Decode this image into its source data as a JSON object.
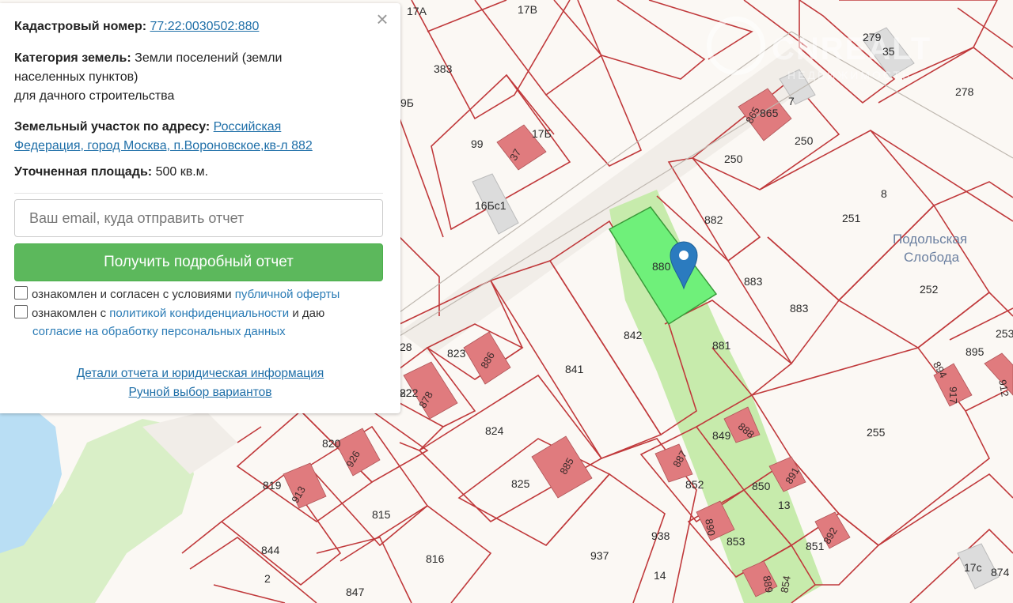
{
  "panel": {
    "close_label": "×",
    "cadastral": {
      "label": "Кадастровый номер:",
      "value": "77:22:0030502:880"
    },
    "category": {
      "label": "Категория земель:",
      "value_line1": "Земли поселений (земли",
      "value_line2": "населенных пунктов)",
      "value_line3": "для дачного строительства"
    },
    "address": {
      "label": "Земельный участок по адресу:",
      "value_line1": "Российская",
      "value_line2": "Федерация, город Москва, п.Вороновское,кв-л 882"
    },
    "area": {
      "label": "Уточненная площадь:",
      "value": "500 кв.м."
    },
    "email_placeholder": "Ваш email, куда отправить отчет",
    "submit_label": "Получить подробный отчет",
    "consent1": {
      "text": "ознакомлен и согласен с условиями",
      "link": "публичной оферты"
    },
    "consent2": {
      "text": "ознакомлен с",
      "link1": "политикой конфиденциальности",
      "text2": "и даю",
      "link2": "согласие на обработку персональных данных"
    },
    "details_link": "Детали отчета и юридическая информация",
    "manual_link": "Ручной выбор вариантов"
  },
  "map": {
    "watermark": "CNREALT",
    "watermark_sub": "НЕДВИЖИМОСТЬ",
    "area_name_line1": "Подольская",
    "area_name_line2": "Слобода",
    "plot_labels": [
      "17А",
      "17В",
      "383",
      "99",
      "17Б",
      "16Бс1",
      "279",
      "35",
      "7",
      "278",
      "250",
      "250",
      "8",
      "882",
      "880",
      "251",
      "252",
      "883",
      "883",
      "881",
      "842",
      "841",
      "823",
      "824",
      "825",
      "822",
      "820",
      "819",
      "815",
      "816",
      "844",
      "847",
      "937",
      "938",
      "852",
      "849",
      "850",
      "851",
      "853",
      "255",
      "895",
      "253",
      "13",
      "14",
      "874",
      "17с",
      "2",
      "28",
      "22",
      "9Б",
      "865"
    ],
    "house_labels": [
      "37",
      "865",
      "886",
      "878",
      "885",
      "926",
      "913",
      "887",
      "888",
      "891",
      "892",
      "890",
      "889",
      "854",
      "894",
      "912",
      "917"
    ],
    "colors": {
      "boundary": "#c0393b",
      "house": "#e07b7e",
      "selected": "#6ff07a",
      "highlight": "#c7ebac",
      "water": "#b9def4",
      "park": "#d9efc7"
    }
  }
}
